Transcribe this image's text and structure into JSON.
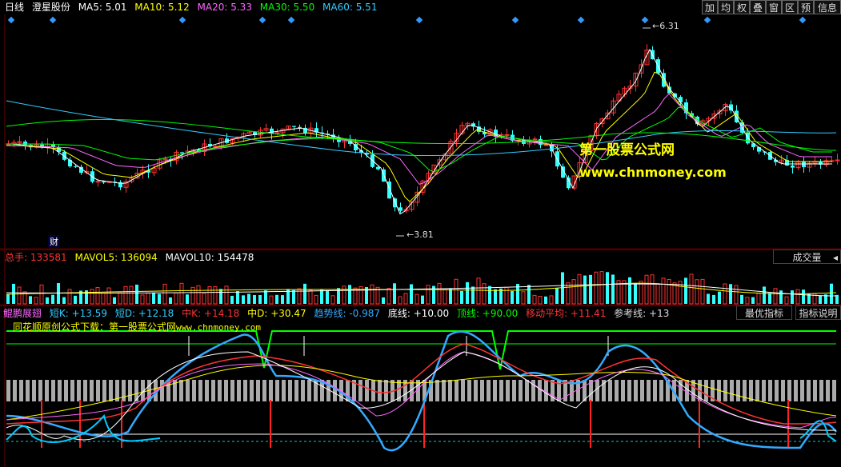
{
  "header": {
    "period": "日线",
    "stock_name": "澄星股份",
    "ma": [
      {
        "label": "MA5: 5.01",
        "color": "#ffffff"
      },
      {
        "label": "MA10: 5.12",
        "color": "#ffff00"
      },
      {
        "label": "MA20: 5.33",
        "color": "#ff66ff"
      },
      {
        "label": "MA30: 5.50",
        "color": "#00ff00"
      },
      {
        "label": "MA60: 5.51",
        "color": "#33ccff"
      }
    ]
  },
  "toolbar": [
    "加",
    "均",
    "权",
    "叠",
    "窗",
    "区",
    "预",
    "信息"
  ],
  "price_chart": {
    "high_label": "6.31",
    "low_label": "3.81",
    "finance_marker": "财"
  },
  "watermark": {
    "line1": "第一股票公式网",
    "line2": "www.chnmoney.com"
  },
  "volume": {
    "total_label": "总手:",
    "total_value": "133581",
    "mavol5": "MAVOL5: 136094",
    "mavol10": "MAVOL10: 154478",
    "dropdown": "成交量"
  },
  "indicator": {
    "name": "鲲鹏展翅",
    "items": [
      {
        "label": "短K: +13.59",
        "color": "#33ccff"
      },
      {
        "label": "短D: +12.18",
        "color": "#33ccff"
      },
      {
        "label": "中K: +14.18",
        "color": "#ff3333"
      },
      {
        "label": "中D: +30.47",
        "color": "#ffff00"
      },
      {
        "label": "趋势线: -0.987",
        "color": "#33aaff"
      },
      {
        "label": "底线: +10.00",
        "color": "#ffffff"
      },
      {
        "label": "顶线: +90.00",
        "color": "#00ff00"
      },
      {
        "label": "移动平均: +11.41",
        "color": "#ff3333"
      },
      {
        "label": "参考线: +13",
        "color": "#dddddd"
      }
    ],
    "optimize_button": "最优指标",
    "help_button": "指标说明",
    "banner_text": "同花顺原创公式下载：第一股票公式网",
    "banner_url": "www.chnmoney.com"
  },
  "colors": {
    "up": "#ff3333",
    "down": "#33ffff",
    "ma5": "#ffffff",
    "ma10": "#ffff00",
    "ma20": "#ff66ff",
    "ma30": "#00ff00",
    "ma60": "#33ccff",
    "top_line": "#00ff00",
    "trend_line": "#33aaff"
  }
}
